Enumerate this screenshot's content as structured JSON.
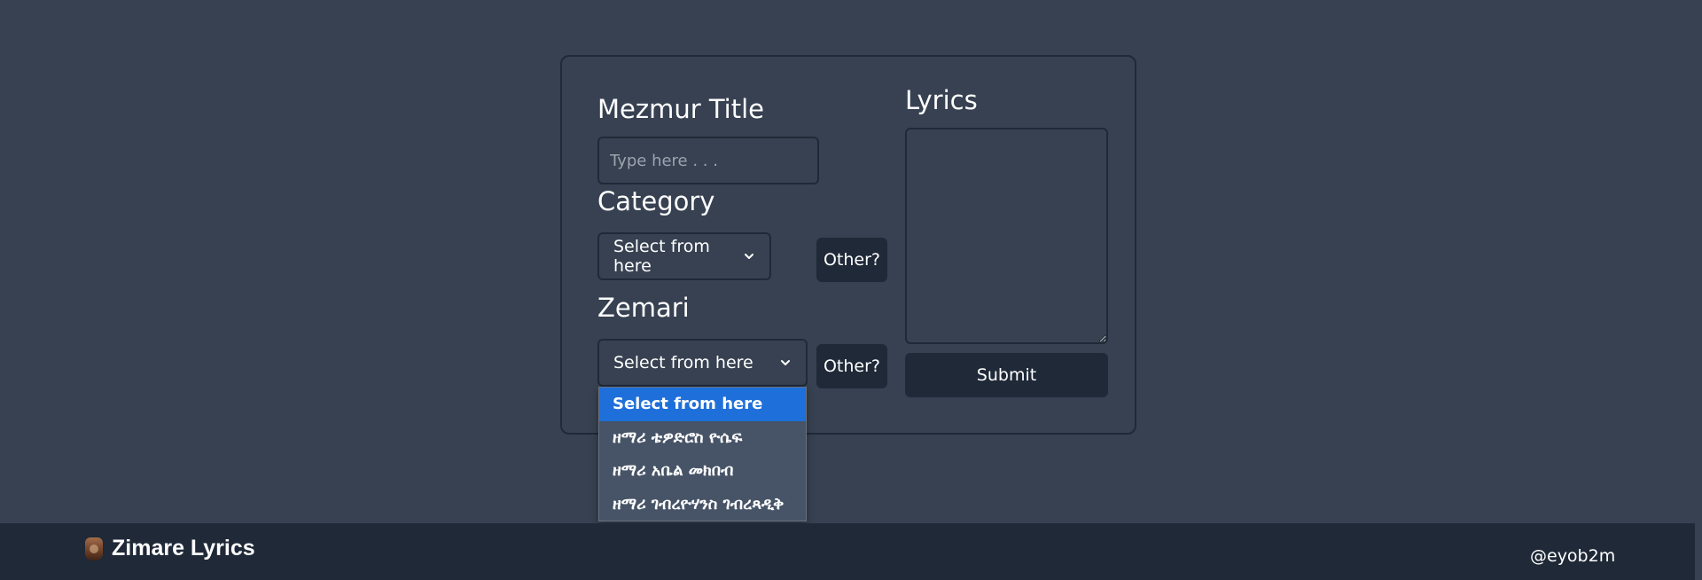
{
  "form": {
    "title_label": "Mezmur Title",
    "title_placeholder": "Type here . . .",
    "category_label": "Category",
    "category_selected": "Select from here",
    "category_other": "Other?",
    "zemari_label": "Zemari",
    "zemari_selected": "Select from here",
    "zemari_other": "Other?",
    "lyrics_label": "Lyrics",
    "submit_label": "Submit"
  },
  "zemari_dropdown": {
    "options": [
      "Select from here",
      "ዘማሪ ቴዎድሮስ ዮሴፍ",
      "ዘማሪ አቤል መክበብ",
      "ዘማሪ ገብረዮሃንስ ገብረጻዲቅ"
    ],
    "highlighted_index": 0
  },
  "footer": {
    "brand": "Zimare Lyrics",
    "handle": "@eyob2m"
  },
  "colors": {
    "page_bg": "#374151",
    "dark": "#1f2937",
    "highlight": "#1e6fd9",
    "dropdown_bg": "#475467"
  },
  "icons": {
    "select_arrow": "chevron-down-icon",
    "brand_logo": "logo-icon"
  }
}
